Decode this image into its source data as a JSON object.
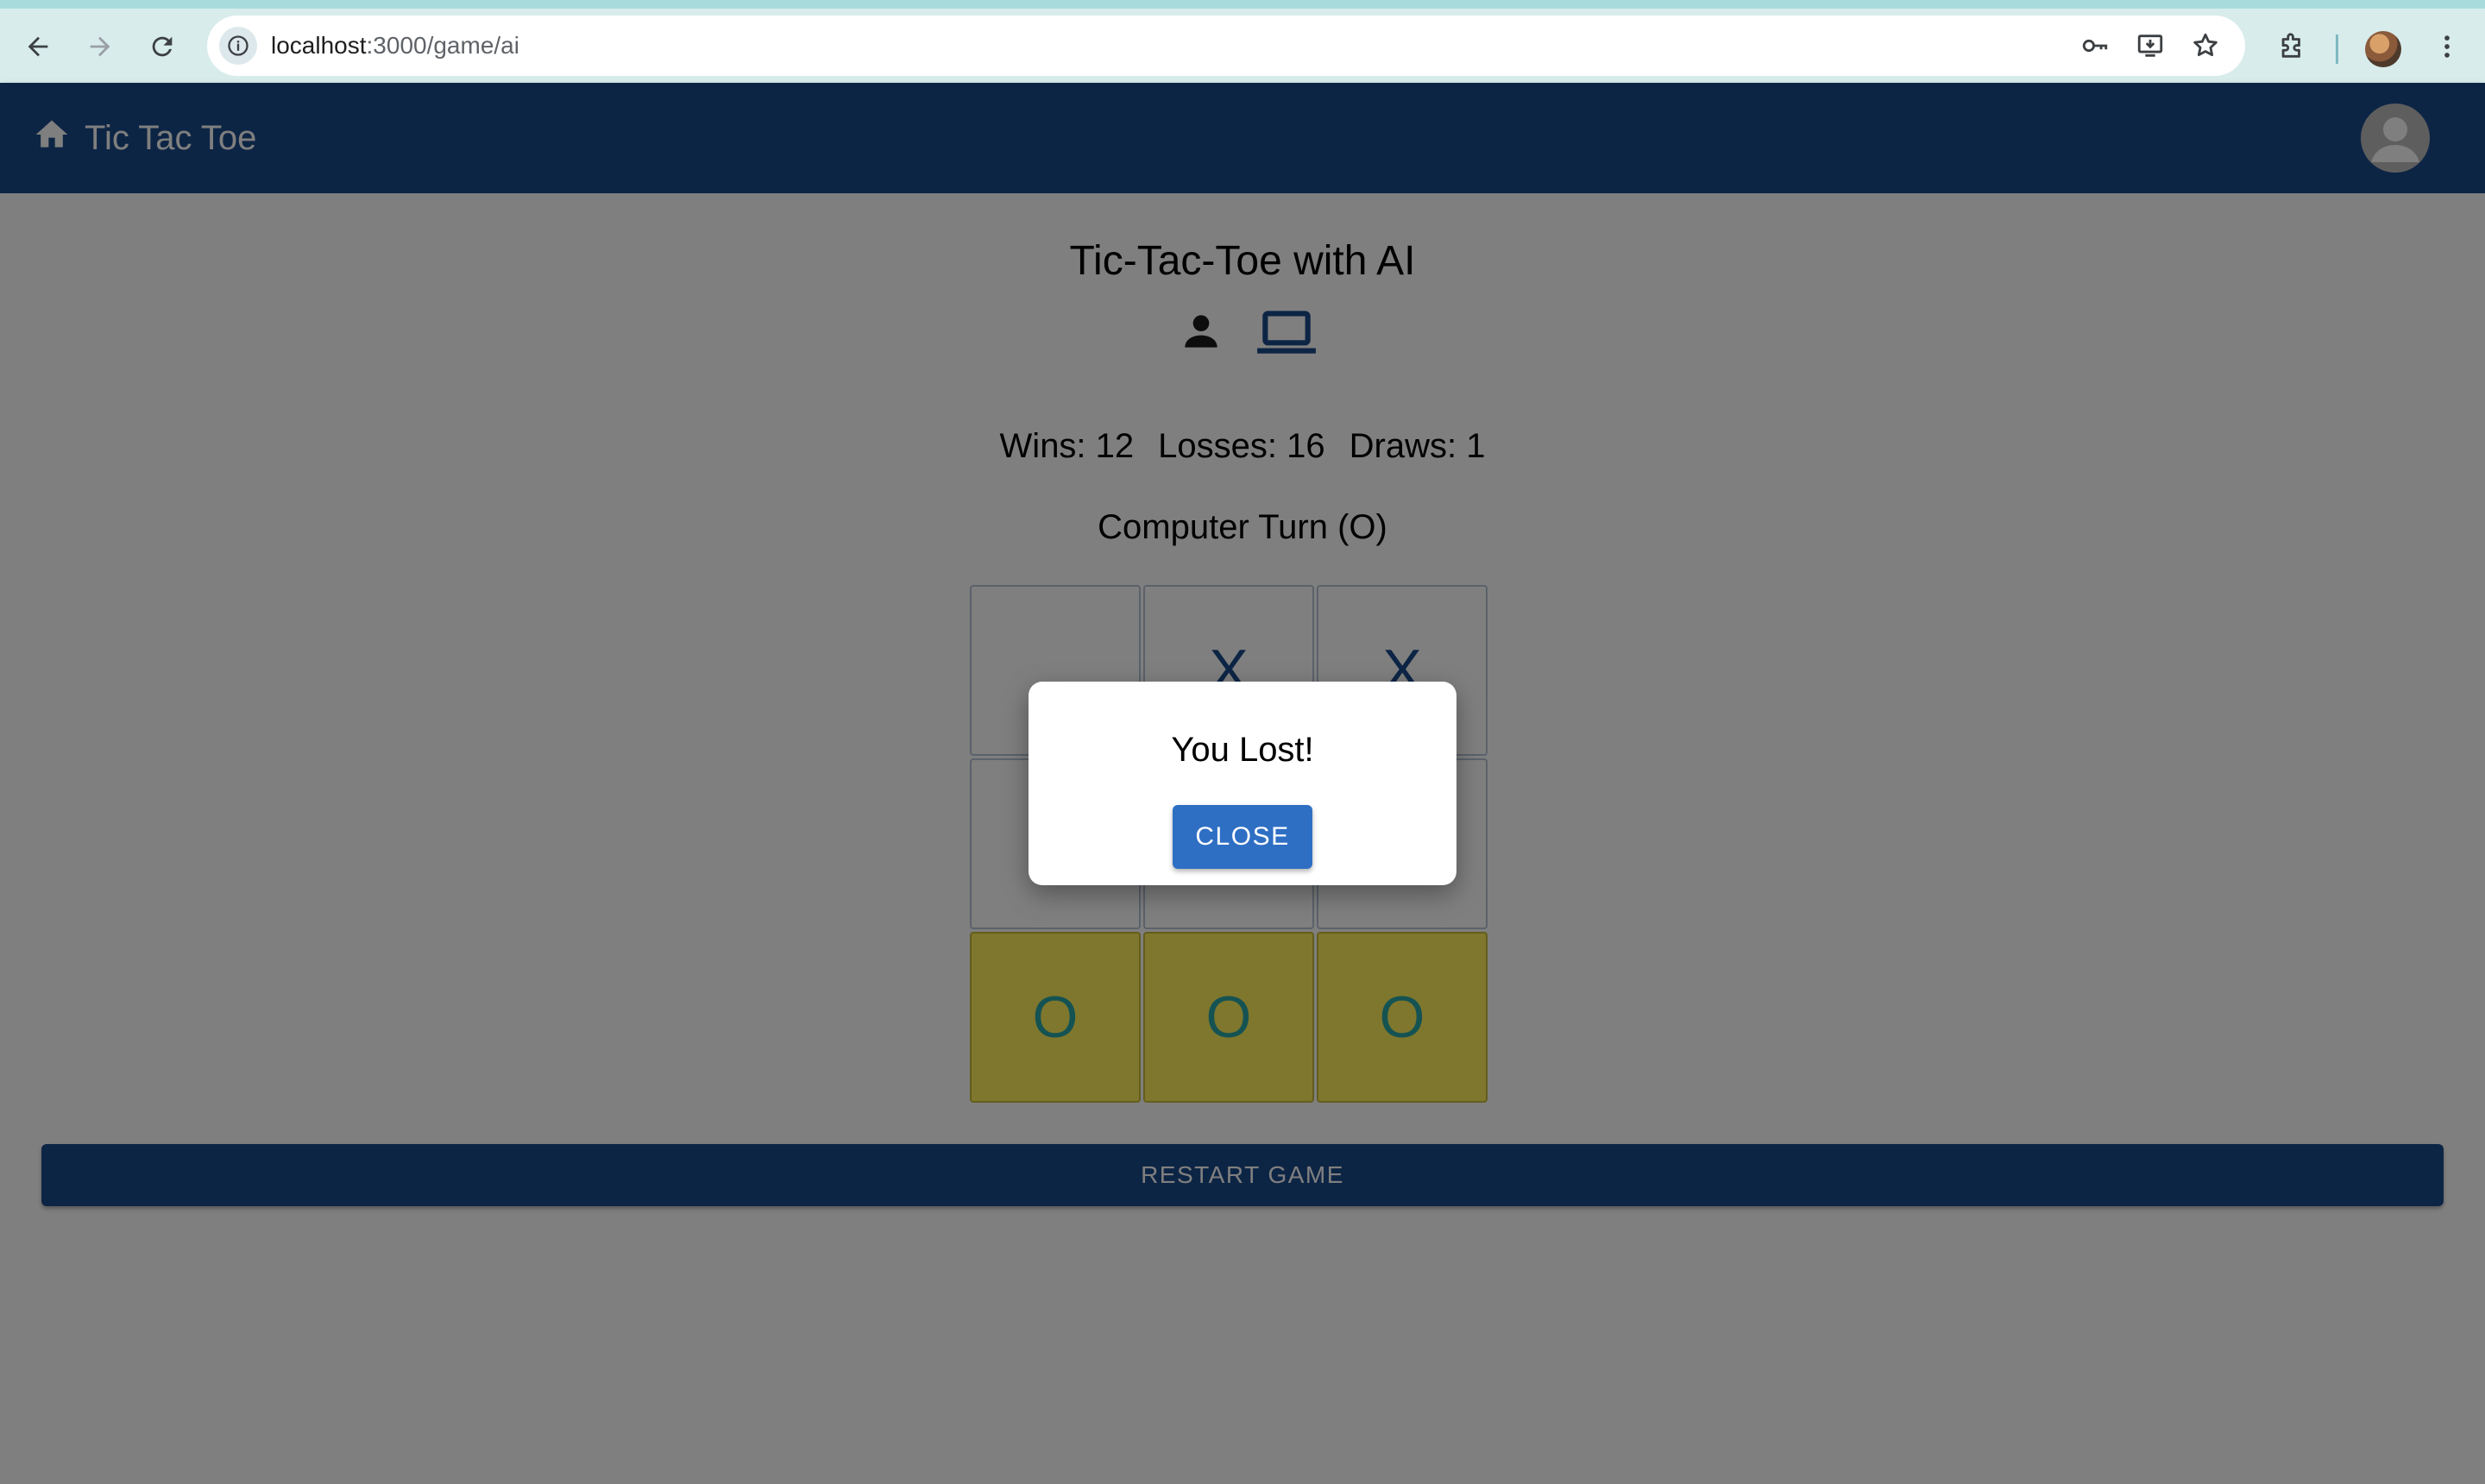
{
  "browser": {
    "url_host": "localhost",
    "url_path": ":3000/game/ai"
  },
  "appbar": {
    "title": "Tic Tac Toe"
  },
  "game": {
    "title": "Tic-Tac-Toe with AI",
    "mode_icons": [
      "person-icon",
      "laptop-icon"
    ],
    "selected_mode": "laptop-icon",
    "stats": {
      "wins": "Wins: 12",
      "losses": "Losses: 16",
      "draws": "Draws: 1"
    },
    "turn": "Computer Turn (O)",
    "board": {
      "cells": [
        "",
        "X",
        "X",
        "",
        "",
        "",
        "O",
        "O",
        "O"
      ],
      "winning_row": [
        6,
        7,
        8
      ]
    },
    "restart_label": "RESTART GAME"
  },
  "dialog": {
    "title": "You Lost!",
    "close_label": "CLOSE"
  },
  "colors": {
    "primary": "#1a4a8a",
    "dialog_button": "#2e6fc4",
    "win_cell": "#ffee5a",
    "o_mark": "#2aa6a6"
  }
}
